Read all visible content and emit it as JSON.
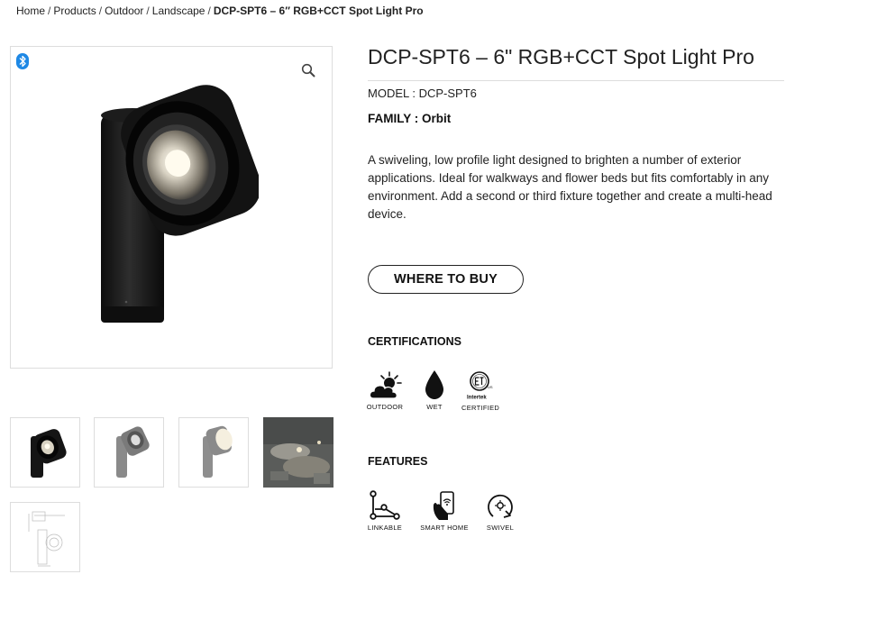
{
  "breadcrumb": {
    "items": [
      "Home",
      "Products",
      "Outdoor",
      "Landscape"
    ],
    "separator": "/",
    "current": "DCP-SPT6 – 6″ RGB+CCT Spot Light Pro"
  },
  "gallery": {
    "badge_icon": "bluetooth-icon",
    "zoom_icon": "magnifier-icon",
    "thumbnails": [
      "front-view",
      "side-view",
      "lit-view",
      "installation-photo",
      "dimension-drawing"
    ]
  },
  "product": {
    "title": "DCP-SPT6 – 6\" RGB+CCT Spot Light Pro",
    "model": "MODEL : DCP-SPT6",
    "family": "FAMILY : Orbit",
    "description": "A swiveling, low profile light designed to brighten a number of exterior applications. Ideal for walkways and flower beds but fits comfortably in any environment. Add a second or third fixture together and create a multi-head device.",
    "where_to_buy": "WHERE TO BUY"
  },
  "certifications": {
    "heading": "CERTIFICATIONS",
    "items": [
      {
        "label": "OUTDOOR",
        "icon": "sun-cloud-icon"
      },
      {
        "label": "WET",
        "icon": "water-drop-icon"
      },
      {
        "label": "CERTIFIED",
        "icon": "etl-intertek-icon",
        "logo_text": "Intertek"
      }
    ]
  },
  "features": {
    "heading": "FEATURES",
    "items": [
      {
        "label": "LINKABLE",
        "icon": "linkable-icon"
      },
      {
        "label": "SMART HOME",
        "icon": "smart-home-icon"
      },
      {
        "label": "SWIVEL",
        "icon": "swivel-icon"
      }
    ]
  },
  "colors": {
    "bluetooth": "#1e88e5",
    "text": "#1a1a1a",
    "border": "#dddddd"
  }
}
